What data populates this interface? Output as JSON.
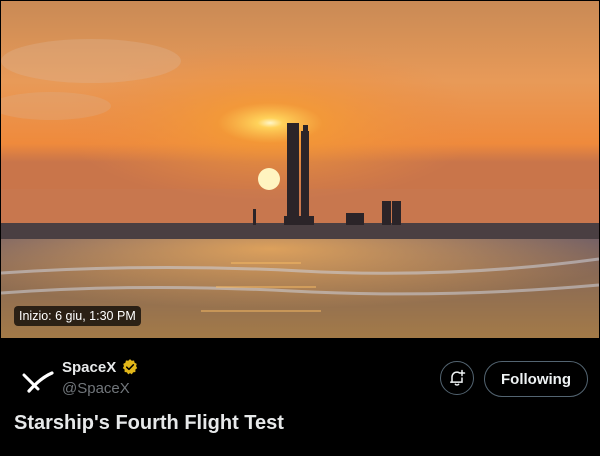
{
  "media": {
    "start_time_badge": "Inizio: 6 giu, 1:30 PM",
    "alt": "Starship launch tower at sunrise over the water"
  },
  "account": {
    "display_name": "SpaceX",
    "handle": "@SpaceX",
    "verified_badge": "gold-verified-icon",
    "avatar_icon": "spacex-x-logo-icon"
  },
  "actions": {
    "bell_icon": "bell-plus-icon",
    "follow_label": "Following"
  },
  "space": {
    "title": "Starship's Fourth Flight Test"
  },
  "colors": {
    "background": "#000000",
    "verified": "#e2b719",
    "text_primary": "#e7e9ea",
    "text_secondary": "#71767b",
    "border": "#536471"
  }
}
